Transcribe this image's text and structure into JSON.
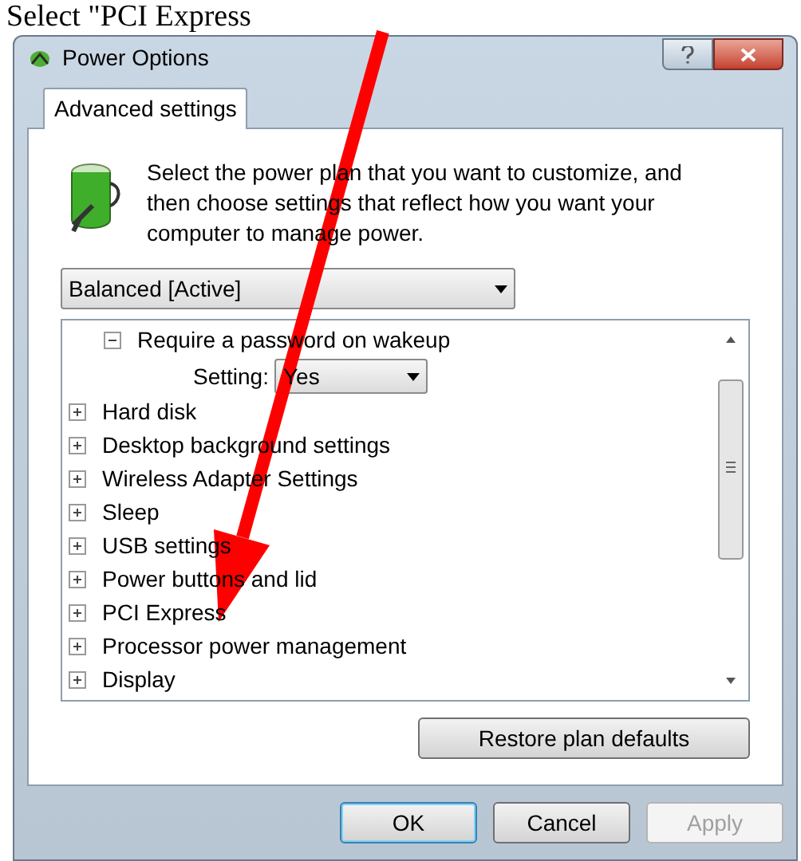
{
  "caption": "Select \"PCI Express",
  "window": {
    "title": "Power Options"
  },
  "tabs": [
    {
      "label": "Advanced settings",
      "selected": true
    }
  ],
  "description": "Select the power plan that you want to customize, and then choose settings that reflect how you want your computer to manage power.",
  "plan_dropdown": {
    "value": "Balanced [Active]"
  },
  "tree": {
    "items": [
      {
        "children": [
          {
            "label": "Require a password on wakeup",
            "expanded": true,
            "children": [
              {
                "kind": "setting",
                "label": "Setting:",
                "value": "Yes"
              }
            ]
          }
        ]
      },
      {
        "label": "Hard disk",
        "expanded": false
      },
      {
        "label": "Desktop background settings",
        "expanded": false
      },
      {
        "label": "Wireless Adapter Settings",
        "expanded": false
      },
      {
        "label": "Sleep",
        "expanded": false
      },
      {
        "label": "USB settings",
        "expanded": false
      },
      {
        "label": "Power buttons and lid",
        "expanded": false
      },
      {
        "label": "PCI Express",
        "expanded": false
      },
      {
        "label": "Processor power management",
        "expanded": false
      },
      {
        "label": "Display",
        "expanded": false
      }
    ]
  },
  "restore_button": "Restore plan defaults",
  "buttons": [
    {
      "label": "OK",
      "default": true,
      "disabled": false
    },
    {
      "label": "Cancel",
      "default": false,
      "disabled": false
    },
    {
      "label": "Apply",
      "default": false,
      "disabled": true
    }
  ]
}
